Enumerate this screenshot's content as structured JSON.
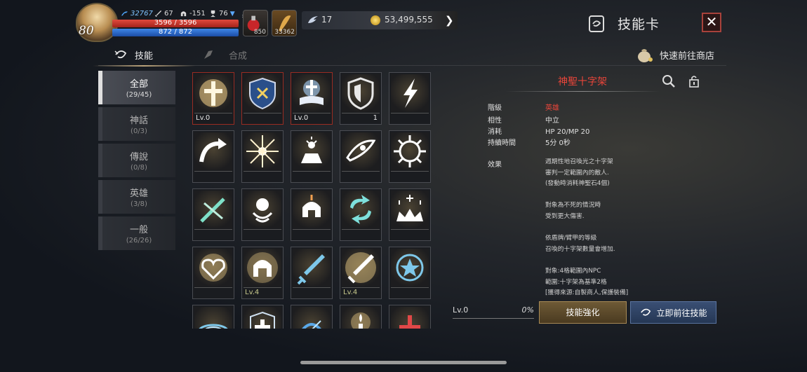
{
  "hud": {
    "level": "80",
    "power": "32767",
    "stat_attack": "67",
    "stat_defense": "-151",
    "stat_trophy": "76",
    "hp_text": "3596 / 3596",
    "mp_text": "872 / 872",
    "potion1_count": "850",
    "potion2_count": "33362",
    "currency_wing": "17",
    "currency_gold": "53,499,555"
  },
  "header": {
    "title": "技能卡",
    "close_symbol": "✕"
  },
  "tabs": {
    "skills": "技能",
    "craft": "合成",
    "shop": "快速前往商店"
  },
  "sidebar": [
    {
      "name": "全部",
      "count": "(29/45)"
    },
    {
      "name": "神話",
      "count": "(0/3)"
    },
    {
      "name": "傳說",
      "count": "(0/8)"
    },
    {
      "name": "英雄",
      "count": "(3/8)"
    },
    {
      "name": "一般",
      "count": "(26/26)"
    }
  ],
  "grid": [
    {
      "icon": "holy-cross-icon",
      "label": "Lv.0",
      "red": true,
      "style": "w"
    },
    {
      "icon": "shield-emblem-icon",
      "label": "",
      "red": true,
      "style": "w"
    },
    {
      "icon": "holy-book-icon",
      "label": "Lv.0",
      "red": true,
      "style": "w"
    },
    {
      "icon": "shield-icon",
      "label": "1",
      "red": false,
      "style": "r"
    },
    {
      "icon": "lightning-icon",
      "label": "",
      "red": false,
      "style": "w"
    },
    {
      "icon": "curved-arrow-icon",
      "label": "",
      "red": false,
      "style": "w"
    },
    {
      "icon": "burst-icon",
      "label": "",
      "red": false,
      "style": "w"
    },
    {
      "icon": "altar-icon",
      "label": "",
      "red": false,
      "style": "w"
    },
    {
      "icon": "eye-icon",
      "label": "",
      "red": false,
      "style": "w"
    },
    {
      "icon": "sunburst-icon",
      "label": "",
      "red": false,
      "style": "w"
    },
    {
      "icon": "crossed-feather-icon",
      "label": "",
      "red": false,
      "style": "w"
    },
    {
      "icon": "orb-icon",
      "label": "",
      "red": false,
      "style": "w"
    },
    {
      "icon": "helmet-icon",
      "label": "",
      "red": false,
      "style": "w"
    },
    {
      "icon": "cycle-icon",
      "label": "",
      "red": false,
      "style": "w"
    },
    {
      "icon": "sparkle-crown-icon",
      "label": "",
      "red": false,
      "style": "w"
    },
    {
      "icon": "heart-icon",
      "label": "",
      "red": false,
      "style": "w"
    },
    {
      "icon": "helmet-glow-icon",
      "label": "Lv.4",
      "red": false,
      "style": "g"
    },
    {
      "icon": "sword-icon",
      "label": "",
      "red": false,
      "style": "w"
    },
    {
      "icon": "golden-sword-icon",
      "label": "Lv.4",
      "red": false,
      "style": "g"
    },
    {
      "icon": "star-sun-icon",
      "label": "",
      "red": false,
      "style": "w"
    },
    {
      "icon": "ring-portal-icon",
      "label": "",
      "red": false,
      "style": "w"
    },
    {
      "icon": "cross-shield-icon",
      "label": "",
      "red": false,
      "style": "w"
    },
    {
      "icon": "blue-arc-icon",
      "label": "",
      "red": false,
      "style": "w"
    },
    {
      "icon": "candle-icon",
      "label": "",
      "red": false,
      "style": "w"
    },
    {
      "icon": "red-cross-icon",
      "label": "",
      "red": false,
      "style": "w"
    }
  ],
  "detail": {
    "name": "神聖十字架",
    "rows": [
      {
        "key": "階級",
        "value": "英雄",
        "highlight": true
      },
      {
        "key": "相性",
        "value": "中立",
        "highlight": false
      },
      {
        "key": "消耗",
        "value": "HP 20/MP 20",
        "highlight": false
      },
      {
        "key": "持續時間",
        "value": "5分 0秒",
        "highlight": false
      }
    ],
    "effect_label": "效果",
    "effect_lines": [
      "週期性地召喚光之十字架",
      "審判一定範圍內的敵人.",
      "(發動時消耗神聖石4個)",
      "",
      "對象為不死的情況時",
      "受到更大傷害.",
      "",
      "依盾牌/臂甲的等級",
      "召喚的十字架數量會增加.",
      "",
      "對象:4格範圍內NPC",
      "範圍:十字架為基準2格",
      "[獲得來源:自製商人,保護裝備]"
    ],
    "level_text": "Lv.0",
    "progress_text": "0%",
    "progress": 0,
    "enhance_button": "技能強化",
    "goto_button": "立即前往技能"
  },
  "colors": {
    "accent_red": "#e8453a",
    "hp": "#c8352a",
    "mp": "#2f6cc9",
    "enhance_gold": "#6e5a36",
    "goto_blue": "#3a4f74"
  }
}
